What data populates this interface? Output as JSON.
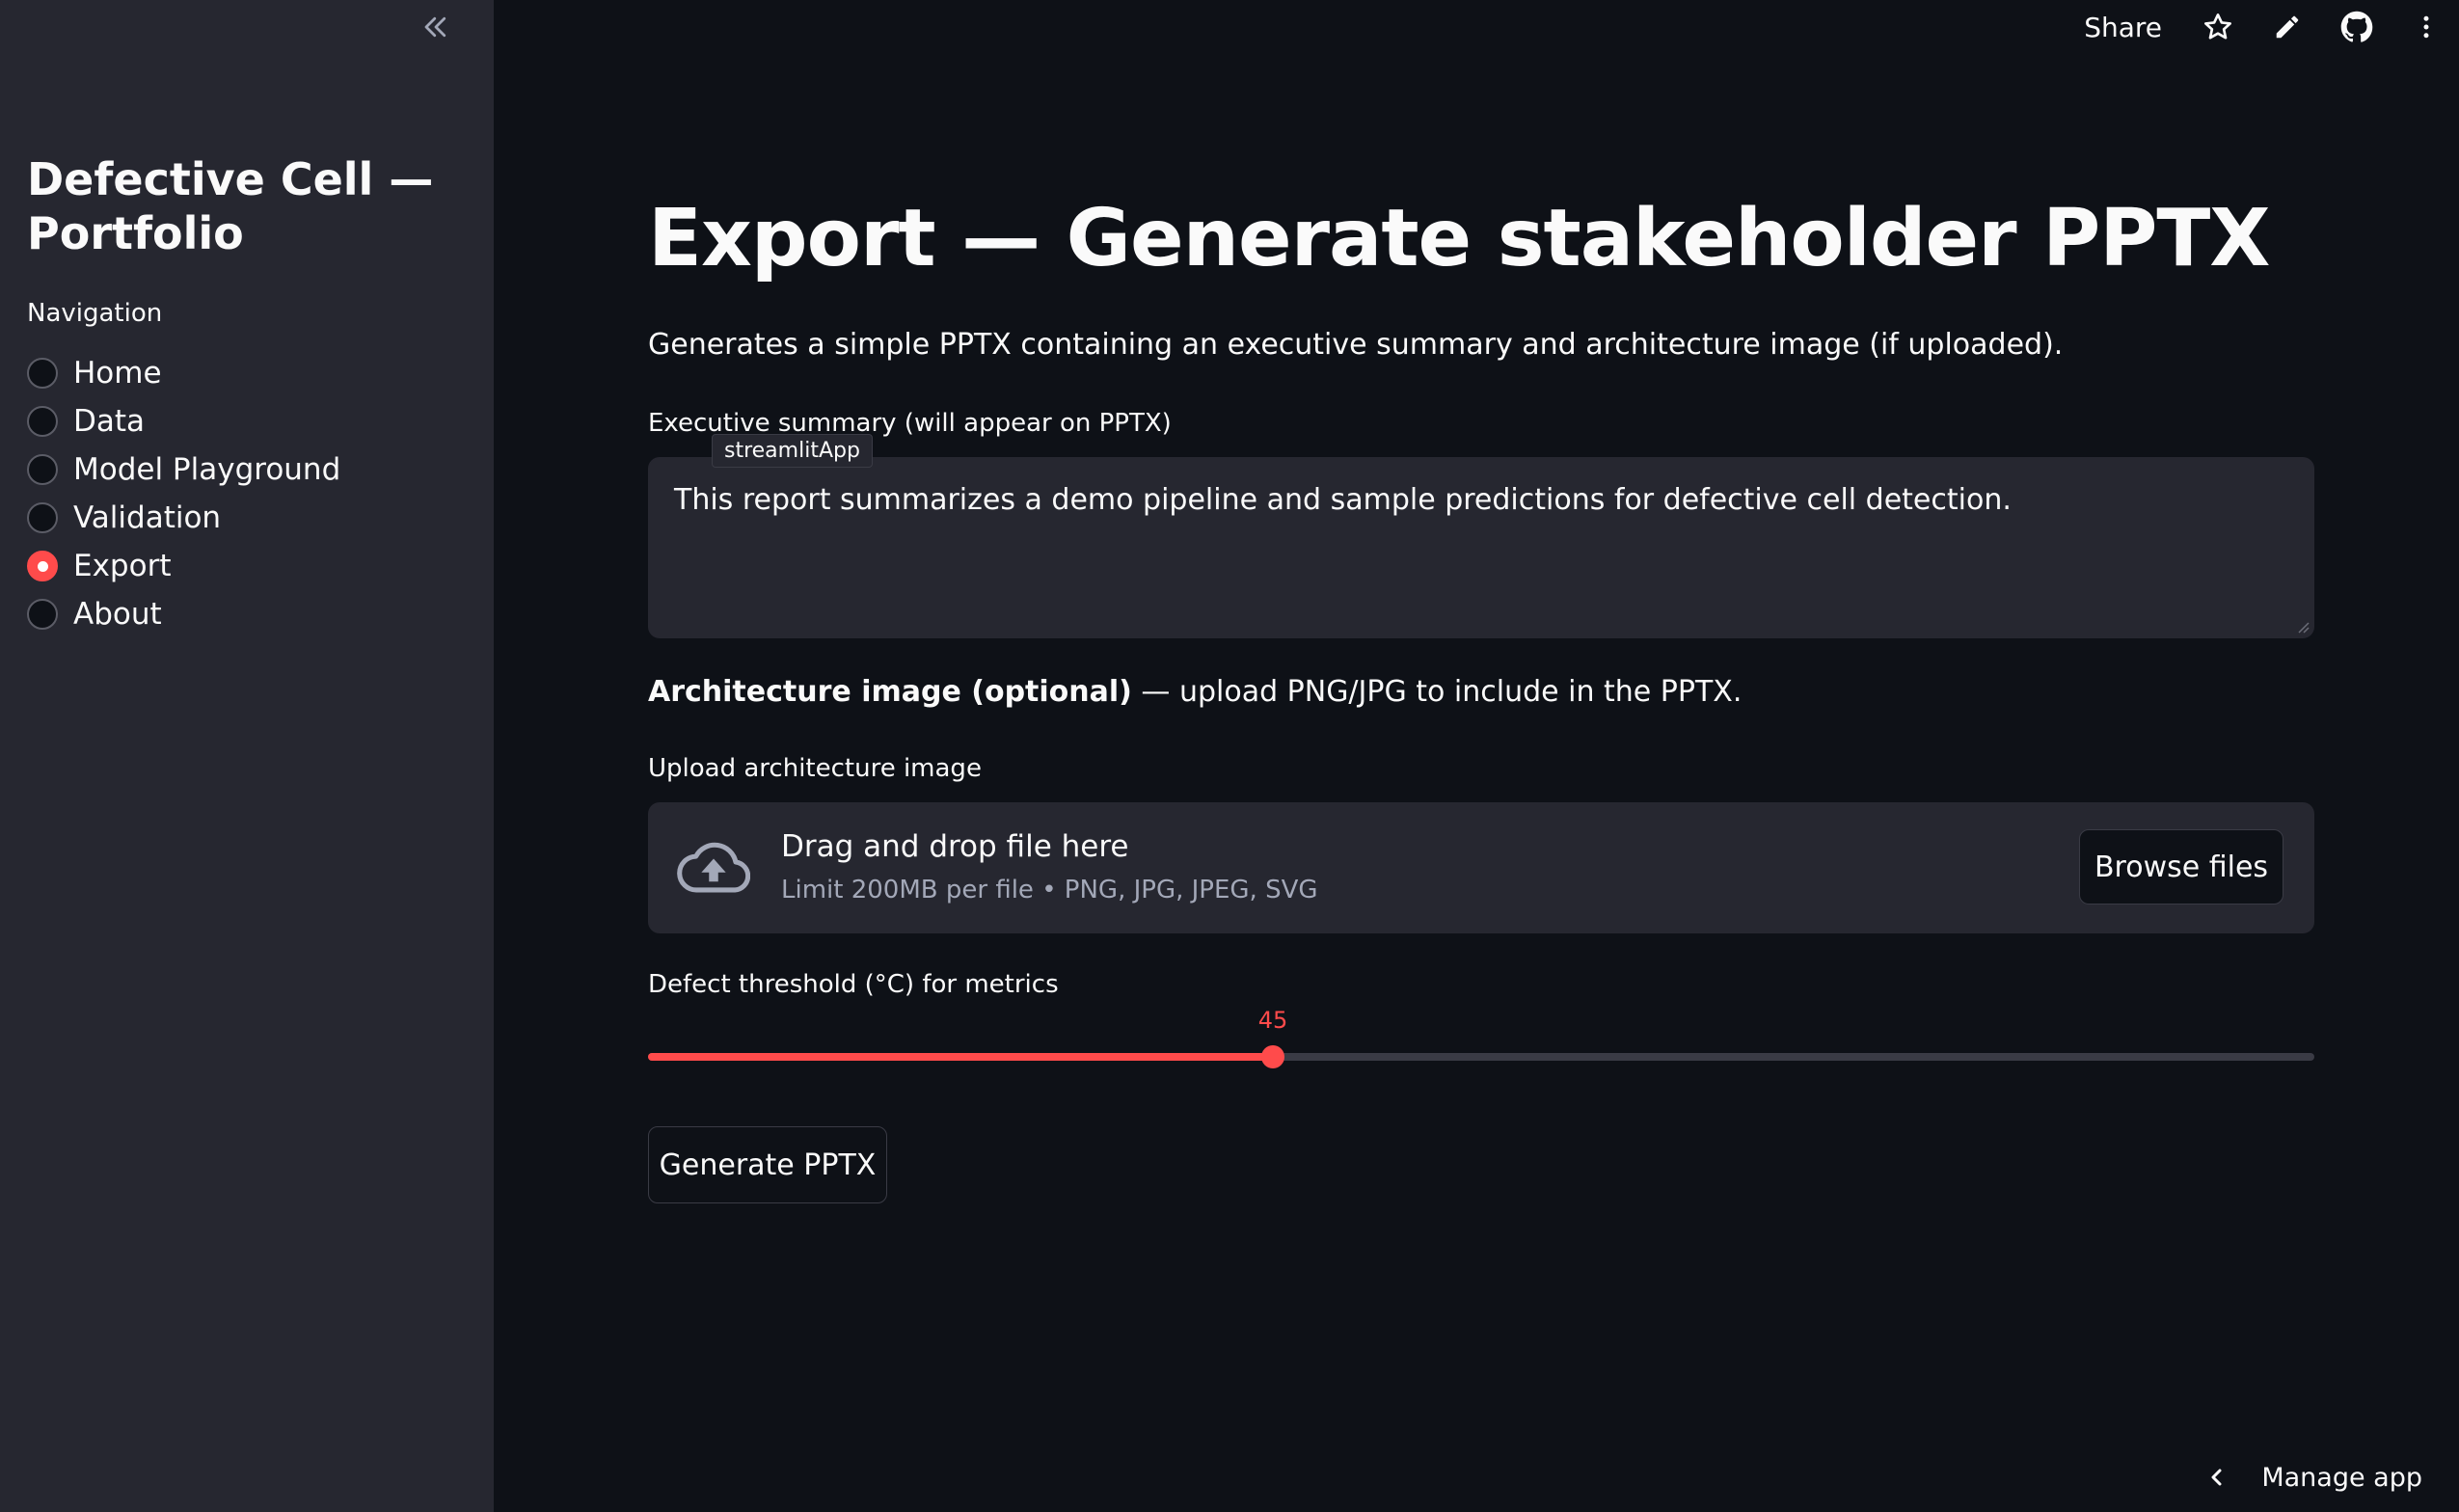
{
  "sidebar": {
    "title": "Defective Cell — Portfolio",
    "nav_label": "Navigation",
    "nav_items": [
      {
        "label": "Home",
        "selected": false
      },
      {
        "label": "Data",
        "selected": false
      },
      {
        "label": "Model Playground",
        "selected": false
      },
      {
        "label": "Validation",
        "selected": false
      },
      {
        "label": "Export",
        "selected": true
      },
      {
        "label": "About",
        "selected": false
      }
    ],
    "collapse_icon": "double-chevron-left-icon"
  },
  "header": {
    "share_label": "Share",
    "icons": [
      "star-icon",
      "pencil-icon",
      "github-icon",
      "more-vertical-icon"
    ]
  },
  "main": {
    "title": "Export — Generate stakeholder PPTX",
    "caption": "Generates a simple PPTX containing an executive summary and architecture image (if uploaded).",
    "summary_label": "Executive summary (will appear on PPTX)",
    "summary_value": "This report summarizes a demo pipeline and sample predictions for defective cell detection.",
    "tooltip": "streamlitApp",
    "arch_bold": "Architecture image (optional)",
    "arch_rest": " — upload PNG/JPG to include in the PPTX.",
    "upload_label": "Upload architecture image",
    "dropzone_title": "Drag and drop file here",
    "dropzone_sub": "Limit 200MB per file • PNG, JPG, JPEG, SVG",
    "browse_label": "Browse files",
    "slider_label": "Defect threshold (°C) for metrics",
    "slider_value": "45",
    "slider_fraction": 0.375,
    "generate_label": "Generate PPTX"
  },
  "footer": {
    "manage_label": "Manage app"
  },
  "colors": {
    "accent": "#ff4b4b",
    "background": "#0e1117",
    "sidebar": "#262730"
  }
}
